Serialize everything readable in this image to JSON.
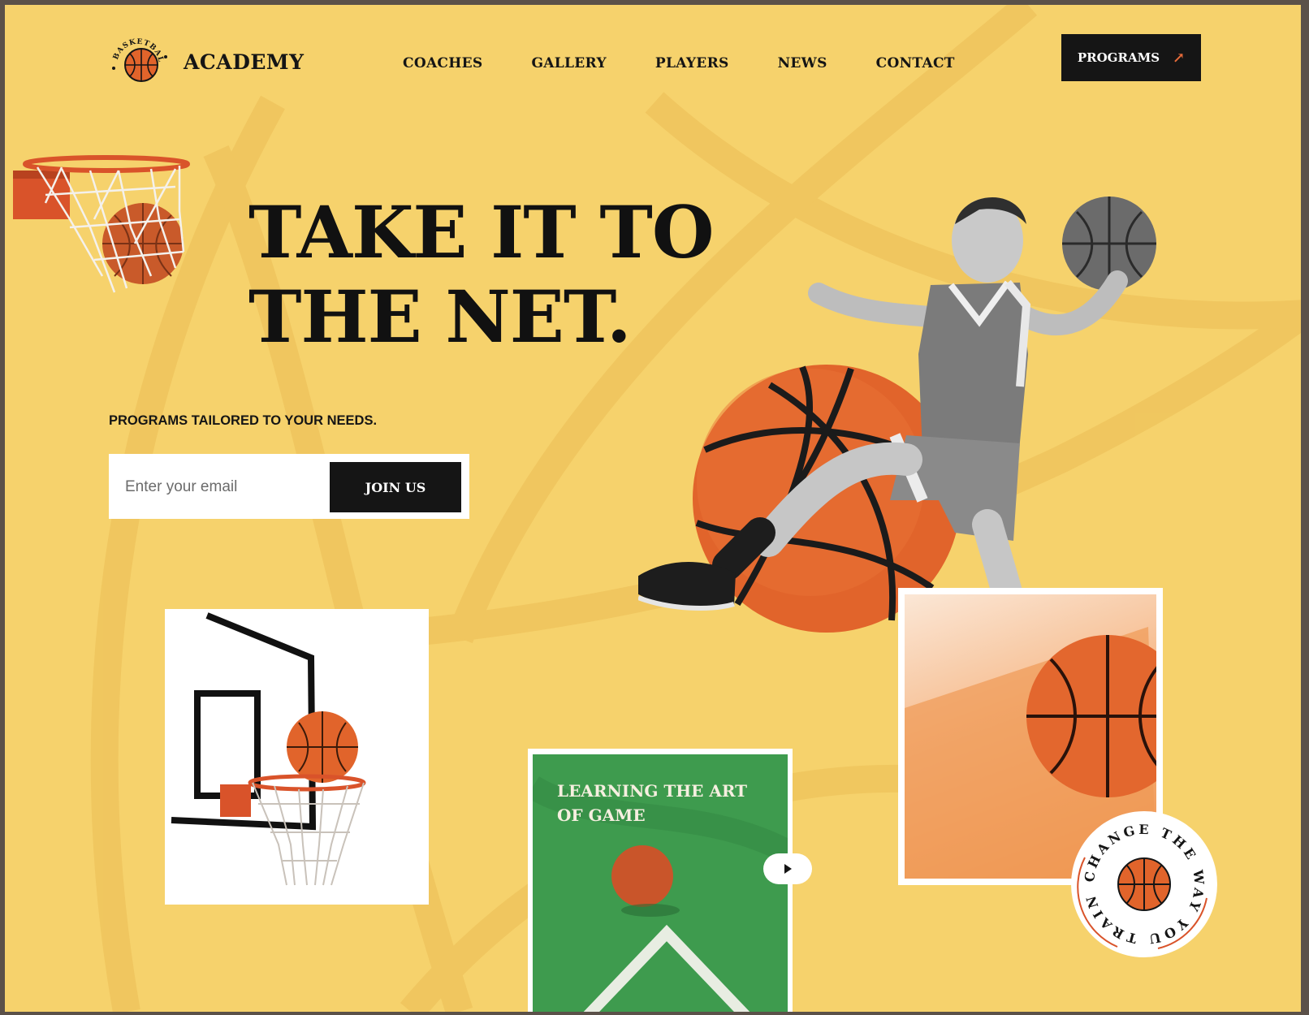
{
  "brand": {
    "name": "ACADEMY",
    "badge_text": "BASKETBALL"
  },
  "nav": {
    "items": [
      "COACHES",
      "GALLERY",
      "PLAYERS",
      "NEWS",
      "CONTACT"
    ]
  },
  "cta": {
    "programs_label": "PROGRAMS",
    "arrow_icon": "arrow-up-right-icon"
  },
  "hero": {
    "headline_line1": "TAKE IT TO",
    "headline_line2": "THE NET.",
    "subtitle": "PROGRAMS TAILORED TO YOUR NEEDS."
  },
  "signup": {
    "placeholder": "Enter your email",
    "value": "",
    "button_label": "JOIN US"
  },
  "cards": {
    "court_title": "LEARNING THE ART OF GAME"
  },
  "circle_badge": {
    "text": "CHANGE THE WAY YOU TRAIN"
  },
  "colors": {
    "background": "#f6d26c",
    "dark": "#151515",
    "accent": "#e76b3a",
    "court_green": "#3d9a4c",
    "ball_orange": "#e1642b"
  }
}
